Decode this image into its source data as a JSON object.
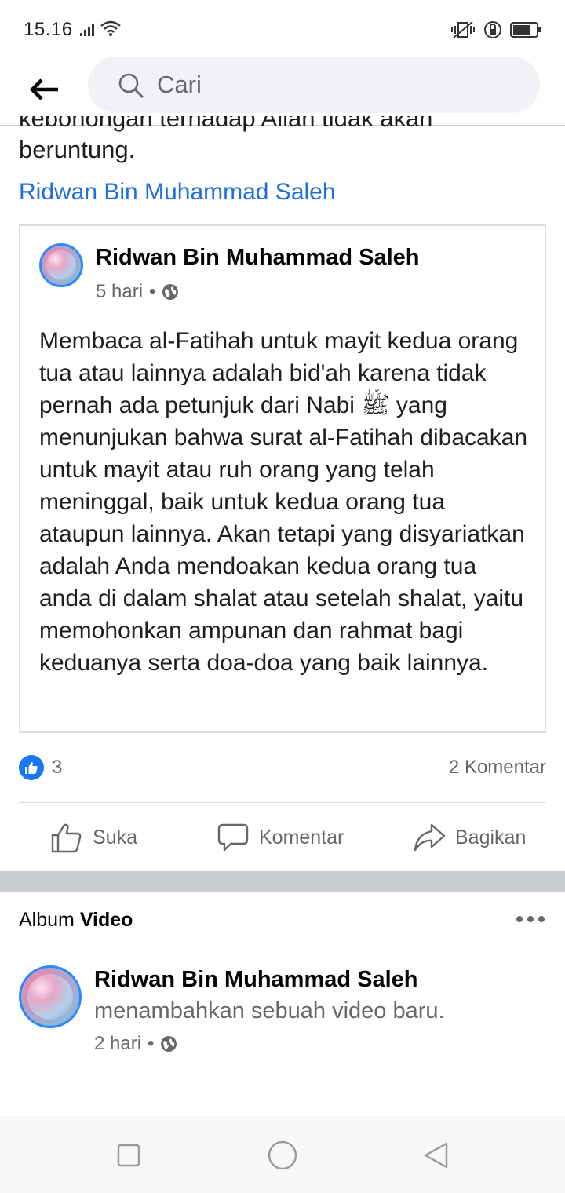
{
  "status_bar": {
    "time": "15.16"
  },
  "search": {
    "placeholder": "Cari"
  },
  "post": {
    "cut_text_line1": "kebohongan terhadap Allah tidak akan",
    "cut_text_line2": "beruntung.",
    "author_link": "Ridwan Bin Muhammad Saleh"
  },
  "shared_post": {
    "author": "Ridwan Bin Muhammad Saleh",
    "time": "5 hari",
    "separator": "•",
    "body": "Membaca al-Fatihah untuk mayit kedua orang tua atau lainnya adalah bid'ah karena tidak pernah ada petunjuk dari Nabi ﷺ yang menunjukan bahwa surat al-Fatihah dibacakan untuk mayit atau ruh orang yang telah meninggal, baik untuk kedua orang tua ataupun lainnya. Akan tetapi yang disyariatkan adalah Anda mendoakan kedua orang tua anda di dalam shalat atau setelah shalat, yaitu memohonkan ampunan dan rahmat bagi keduanya serta doa-doa yang baik lainnya."
  },
  "reactions": {
    "count": "3",
    "comments": "2 Komentar"
  },
  "actions": {
    "like": "Suka",
    "comment": "Komentar",
    "share": "Bagikan"
  },
  "album": {
    "label_prefix": "Album",
    "label_bold": "Video"
  },
  "story": {
    "author": "Ridwan Bin Muhammad Saleh",
    "action": "menambahkan sebuah video baru.",
    "time": "2 hari",
    "separator": "•"
  },
  "colors": {
    "link": "#216fdb",
    "like_blue": "#1877f2",
    "secondary_text": "#65676b"
  }
}
